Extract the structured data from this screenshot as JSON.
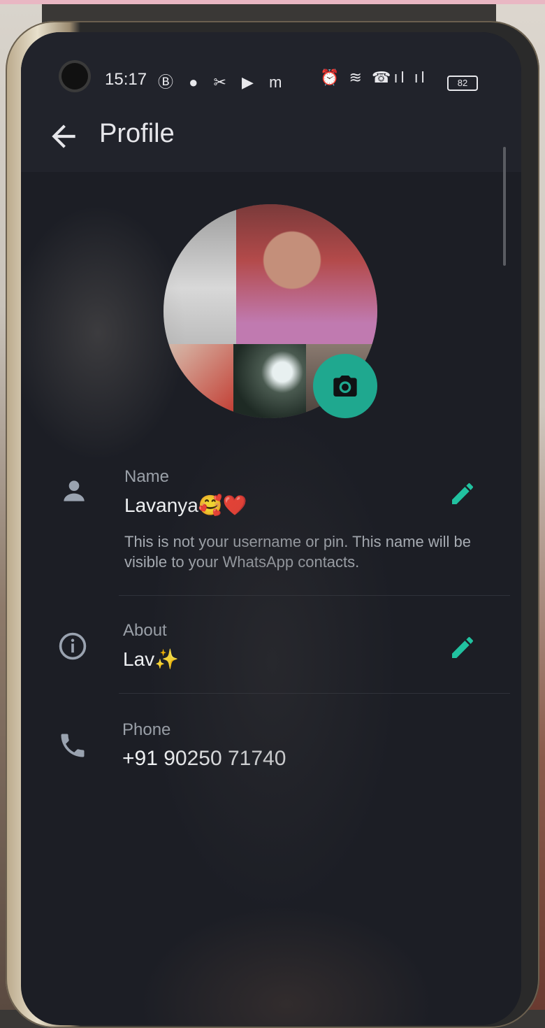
{
  "status_bar": {
    "time": "15:17",
    "left_icons": "Ⓑ ● ✂ ▶ m",
    "right_icons": "⏰ ≋ ☎ıl ıl",
    "battery": "82"
  },
  "app_bar": {
    "title": "Profile"
  },
  "profile": {
    "name_label": "Name",
    "name_value": "Lavanya🥰❤️",
    "name_hint": "This is not your username or pin. This name will be visible to your WhatsApp contacts.",
    "about_label": "About",
    "about_value": "Lav✨",
    "phone_label": "Phone",
    "phone_value": "+91 90250 71740"
  },
  "colors": {
    "accent": "#1fa88f",
    "background": "#1c1e25",
    "app_bar": "#21232b"
  },
  "icons": [
    "back-arrow-icon",
    "camera-icon",
    "person-icon",
    "info-icon",
    "phone-icon",
    "pencil-icon"
  ]
}
